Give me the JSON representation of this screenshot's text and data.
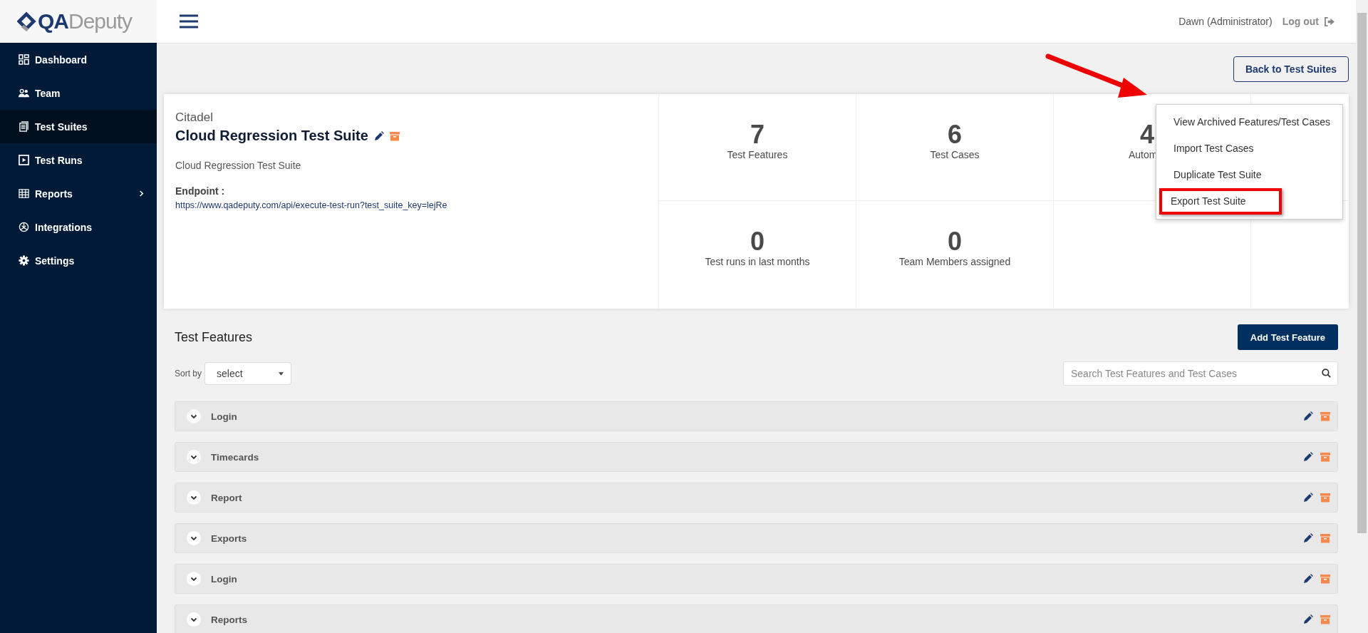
{
  "logo": {
    "strong": "QA",
    "light": "Deputy"
  },
  "sidebar": {
    "items": [
      {
        "label": "Dashboard",
        "selected": false,
        "has_submenu": false
      },
      {
        "label": "Team",
        "selected": false,
        "has_submenu": false
      },
      {
        "label": "Test Suites",
        "selected": true,
        "has_submenu": false
      },
      {
        "label": "Test Runs",
        "selected": false,
        "has_submenu": false
      },
      {
        "label": "Reports",
        "selected": false,
        "has_submenu": true
      },
      {
        "label": "Integrations",
        "selected": false,
        "has_submenu": false
      },
      {
        "label": "Settings",
        "selected": false,
        "has_submenu": false
      }
    ]
  },
  "header": {
    "user": "Dawn (Administrator)",
    "logout": "Log out"
  },
  "back_button": "Back to Test Suites",
  "suite": {
    "project": "Citadel",
    "title": "Cloud Regression Test Suite",
    "description": "Cloud Regression Test Suite",
    "endpoint_label": "Endpoint :",
    "endpoint_url": "https://www.qadeputy.com/api/execute-test-run?test_suite_key=lejRe"
  },
  "stats": [
    {
      "kind": "full",
      "value": "7",
      "label": "Test Features"
    },
    {
      "kind": "full",
      "value": "6",
      "label": "Test Cases"
    },
    {
      "kind": "cut",
      "value": "4",
      "label": "Autom"
    },
    {
      "kind": "empty"
    },
    {
      "kind": "full",
      "value": "0",
      "label": "Test runs in last months"
    },
    {
      "kind": "full",
      "value": "0",
      "label": "Team Members assigned"
    },
    {
      "kind": "empty"
    },
    {
      "kind": "empty"
    }
  ],
  "menu": {
    "items": [
      {
        "label": "View Archived Features/Test Cases",
        "highlighted": false
      },
      {
        "label": "Import Test Cases",
        "highlighted": false
      },
      {
        "label": "Duplicate Test Suite",
        "highlighted": false
      },
      {
        "label": "Export Test Suite",
        "highlighted": true
      }
    ]
  },
  "features": {
    "title": "Test Features",
    "add_button": "Add Test Feature",
    "sort_label": "Sort by",
    "sort_value": "select",
    "search": {
      "placeholder": "Search Test Features and Test Cases"
    },
    "rows": [
      {
        "name": "Login"
      },
      {
        "name": "Timecards"
      },
      {
        "name": "Report"
      },
      {
        "name": "Exports"
      },
      {
        "name": "Login"
      },
      {
        "name": "Reports"
      }
    ]
  }
}
